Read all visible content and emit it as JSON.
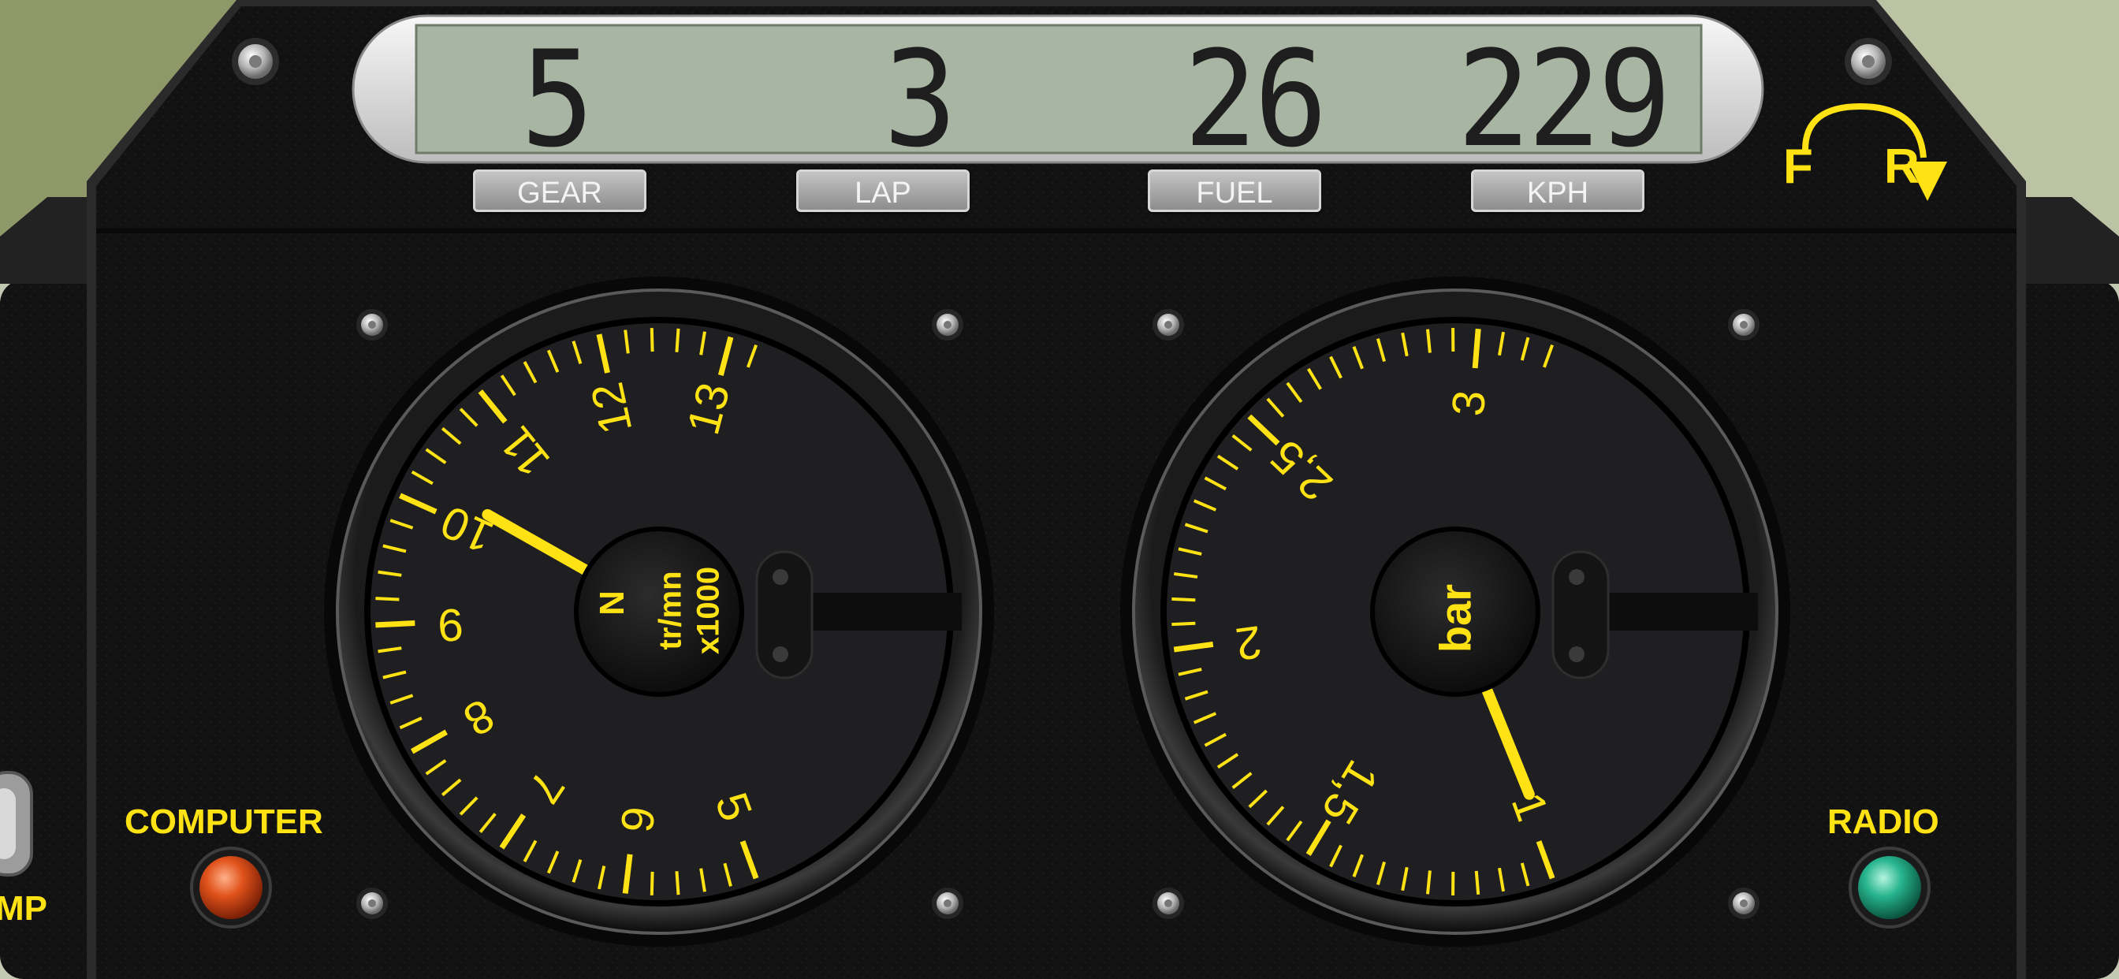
{
  "dashboard": {
    "readout": {
      "gear": "5",
      "lap": "3",
      "fuel": "26",
      "kph": "229"
    },
    "labels": {
      "gear": "GEAR",
      "lap": "LAP",
      "fuel": "FUEL",
      "kph": "KPH"
    },
    "direction": {
      "forward": "F",
      "reverse": "R"
    },
    "computer_label": "COMPUTER",
    "radio_label": "RADIO",
    "left_edge_label": "MP"
  },
  "tachometer": {
    "neutral_label": "N",
    "unit": "tr/mn",
    "multiplier": "x1000",
    "tick_labels": [
      "5",
      "6",
      "7",
      "8",
      "9",
      "10",
      "11",
      "12",
      "13"
    ],
    "needle_value": 10.2
  },
  "pressure_gauge": {
    "unit": "bar",
    "tick_labels": [
      "1",
      "1,5",
      "2",
      "2,5",
      "3"
    ],
    "needle_value": 0.98
  },
  "colors": {
    "gauge_yellow": "#ffe214",
    "lcd_background": "#a9b5a3",
    "computer_lamp": "#e0521b",
    "radio_lamp": "#27b48e"
  }
}
